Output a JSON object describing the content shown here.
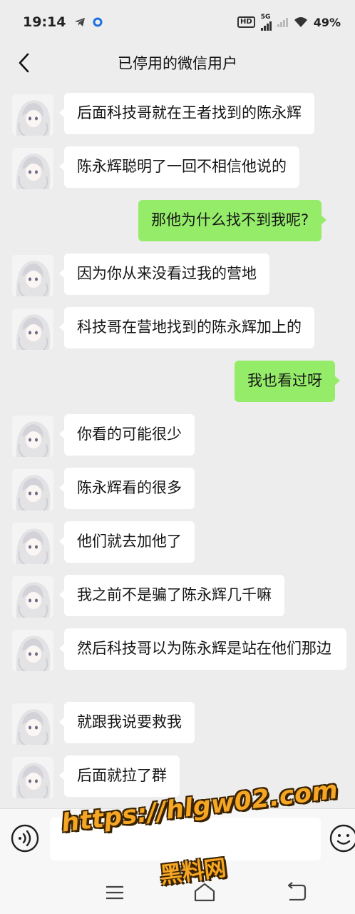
{
  "status_bar": {
    "time": "19:14",
    "network": "5G",
    "hd": "HD",
    "battery": "49%"
  },
  "header": {
    "title": "已停用的微信用户"
  },
  "messages": [
    {
      "side": "in",
      "text": "后面科技哥就在王者找到的陈永辉"
    },
    {
      "side": "in",
      "text": "陈永辉聪明了一回不相信他说的"
    },
    {
      "side": "out",
      "text": "那他为什么找不到我呢?"
    },
    {
      "side": "in",
      "text": "因为你从来没看过我的营地"
    },
    {
      "side": "in",
      "text": "科技哥在营地找到的陈永辉加上的"
    },
    {
      "side": "out",
      "text": "我也看过呀"
    },
    {
      "side": "in",
      "text": "你看的可能很少"
    },
    {
      "side": "in",
      "text": "陈永辉看的很多"
    },
    {
      "side": "in",
      "text": "他们就去加他了"
    },
    {
      "side": "in",
      "text": "我之前不是骗了陈永辉几千嘛"
    },
    {
      "side": "in",
      "text": "然后科技哥以为陈永辉是站在他们那边"
    },
    {
      "side": "in",
      "text": "就跟我说要救我"
    },
    {
      "side": "in",
      "text": "后面就拉了群"
    }
  ],
  "watermark": {
    "url": "https://hlgw02.com",
    "name": "黑料网"
  },
  "colors": {
    "background": "#ededed",
    "incoming_bubble": "#ffffff",
    "outgoing_bubble": "#95ec69",
    "watermark": "#f5a623"
  },
  "icons": {
    "back": "chevron-left-icon",
    "voice": "voice-icon",
    "emoji": "emoji-icon",
    "nav_menu": "menu-icon",
    "nav_home": "home-icon",
    "nav_back": "back-nav-icon"
  }
}
